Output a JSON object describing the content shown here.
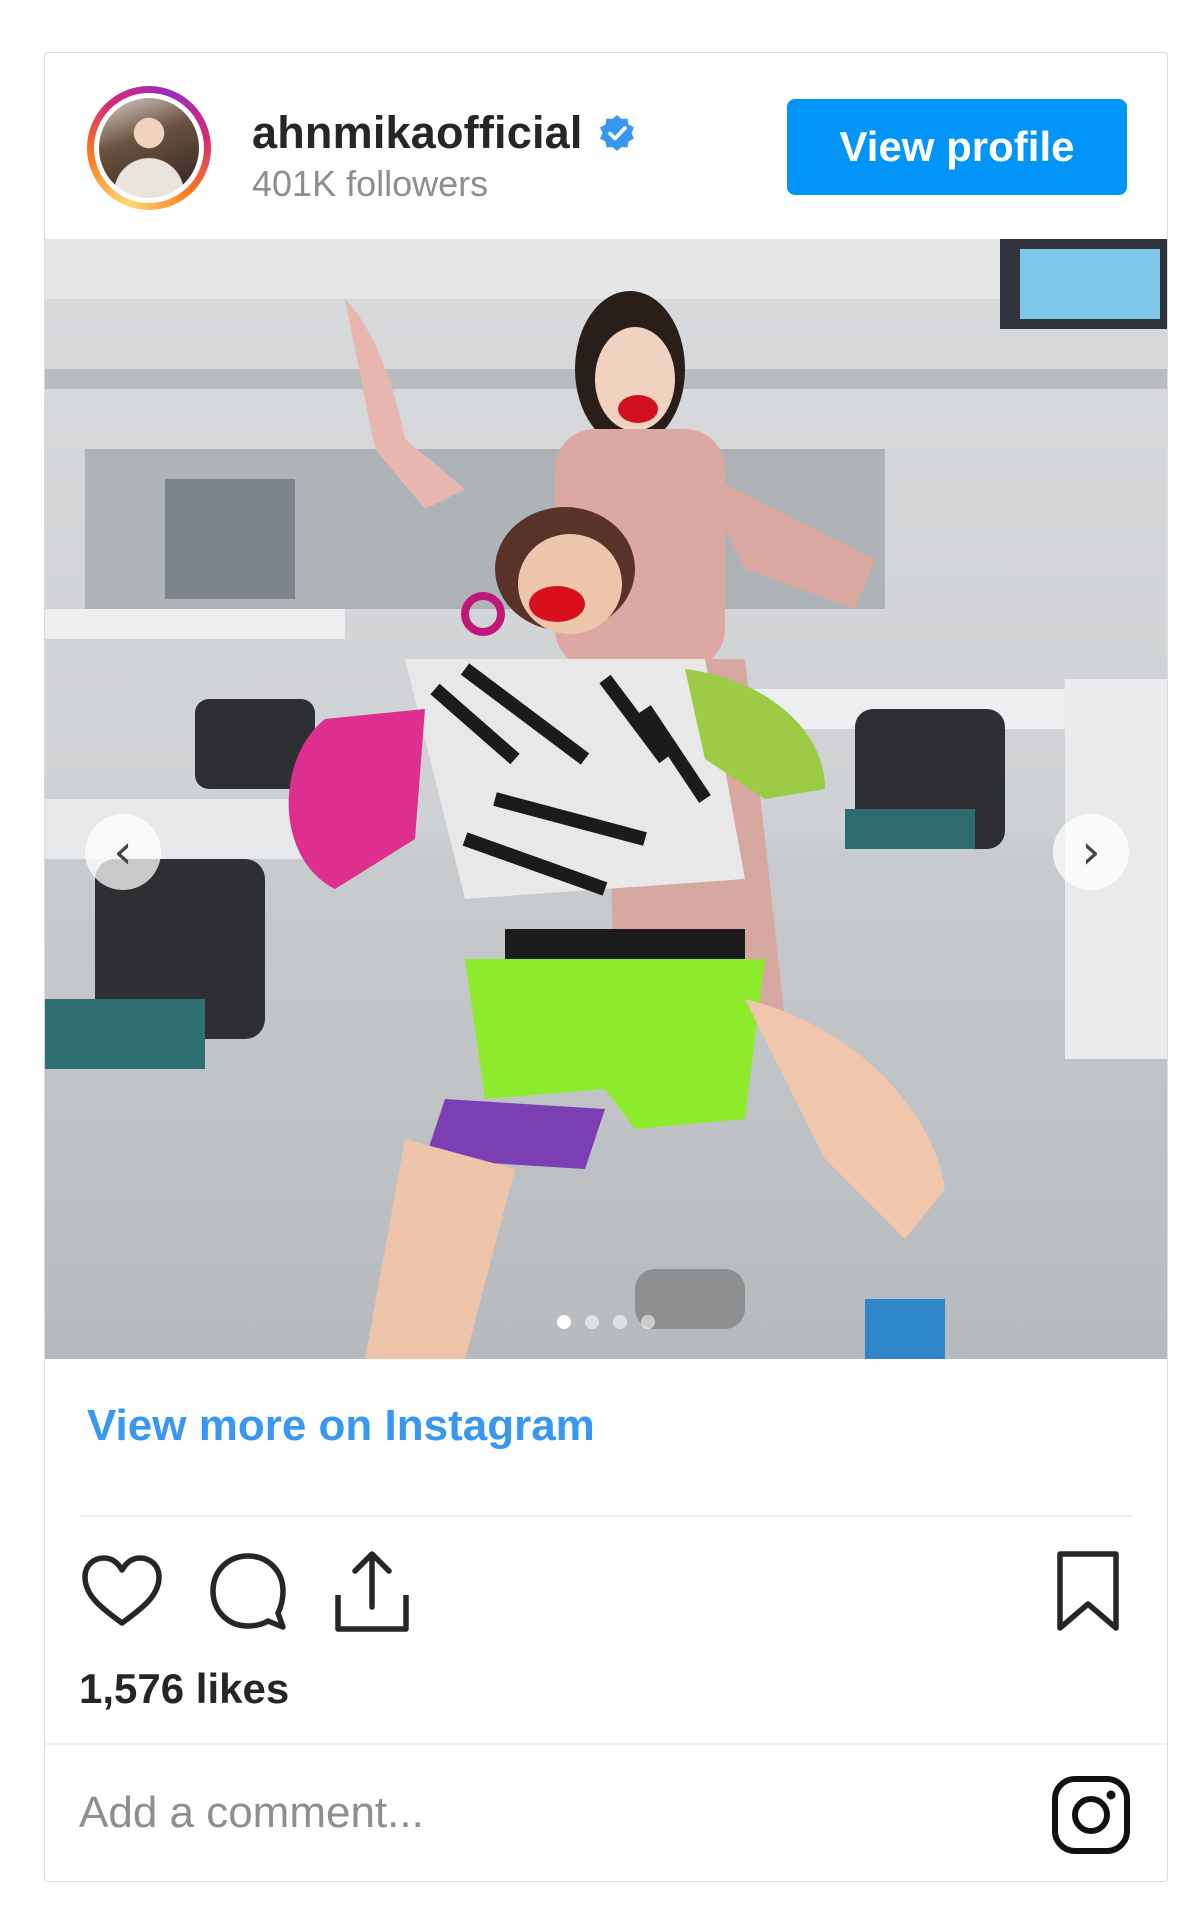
{
  "header": {
    "username": "ahnmikaofficial",
    "followers": "401K followers",
    "view_profile_label": "View profile",
    "verified": true
  },
  "media": {
    "carousel_prev_glyph": "‹",
    "carousel_next_glyph": "›",
    "slide_count": 4,
    "active_slide": 1
  },
  "footer": {
    "view_more_label": "View more on Instagram",
    "likes": "1,576 likes",
    "comment_placeholder": "Add a comment..."
  },
  "icons": {
    "like": "heart-icon",
    "comment": "comment-icon",
    "share": "share-icon",
    "save": "bookmark-icon",
    "brand": "instagram-logo-icon",
    "verified": "verified-badge-icon"
  },
  "colors": {
    "accent": "#0095f6",
    "link": "#3897f0",
    "text": "#262626",
    "muted": "#8e8e8e",
    "border": "#dbdbdb"
  }
}
